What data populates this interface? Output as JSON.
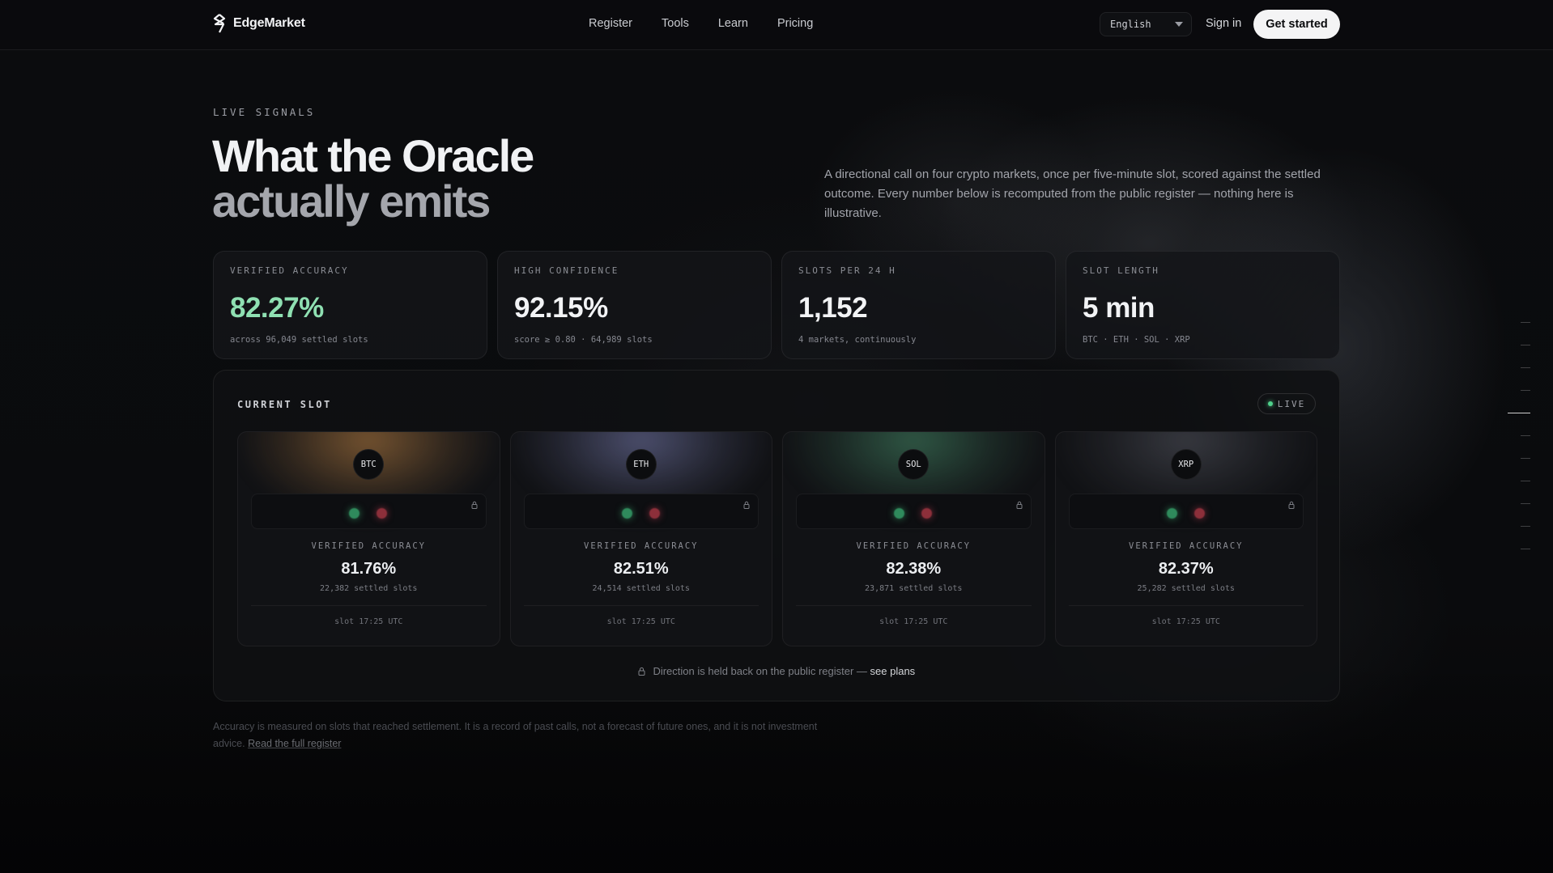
{
  "brand": {
    "name": "EdgeMarket",
    "logo_icon": "s-logo-icon"
  },
  "nav": {
    "links": [
      "Register",
      "Tools",
      "Learn",
      "Pricing"
    ],
    "language": "English",
    "sign_in": "Sign in",
    "cta": "Get started"
  },
  "hero": {
    "eyebrow": "LIVE SIGNALS",
    "title_line1": "What the Oracle",
    "title_line2": "actually emits",
    "lede": "A directional call on four crypto markets, once per five-minute slot, scored against the settled outcome. Every number below is recomputed from the public register — nothing here is illustrative."
  },
  "stats": [
    {
      "label": "VERIFIED ACCURACY",
      "value": "82.27%",
      "sub": "across 96,049 settled slots",
      "accent": "#8fe0b2"
    },
    {
      "label": "HIGH CONFIDENCE",
      "value": "92.15%",
      "sub": "score ≥ 0.80 · 64,989 slots"
    },
    {
      "label": "SLOTS PER 24 H",
      "value": "1,152",
      "sub": "4 markets, continuously"
    },
    {
      "label": "SLOT LENGTH",
      "value": "5 min",
      "sub": "BTC · ETH · SOL · XRP"
    }
  ],
  "current_slot": {
    "title": "CURRENT SLOT",
    "live_label": "LIVE",
    "markets": [
      {
        "symbol": "BTC",
        "label": "VERIFIED ACCURACY",
        "accuracy": "81.76%",
        "settled": "22,382 settled slots",
        "slot": "slot 17:25 UTC",
        "glow": "#a7743e"
      },
      {
        "symbol": "ETH",
        "label": "VERIFIED ACCURACY",
        "accuracy": "82.51%",
        "settled": "24,514 settled slots",
        "slot": "slot 17:25 UTC",
        "glow": "#6a6e9a"
      },
      {
        "symbol": "SOL",
        "label": "VERIFIED ACCURACY",
        "accuracy": "82.38%",
        "settled": "23,871 settled slots",
        "slot": "slot 17:25 UTC",
        "glow": "#3f7a5d"
      },
      {
        "symbol": "XRP",
        "label": "VERIFIED ACCURACY",
        "accuracy": "82.37%",
        "settled": "25,282 settled slots",
        "slot": "slot 17:25 UTC",
        "glow": "#4a4c55"
      }
    ],
    "held_text": "Direction is held back on the public register —",
    "held_link": "see plans"
  },
  "disclaimer": {
    "text": "Accuracy is measured on slots that reached settlement. It is a record of past calls, not a forecast of future ones, and it is not investment advice.",
    "link": "Read the full register"
  }
}
